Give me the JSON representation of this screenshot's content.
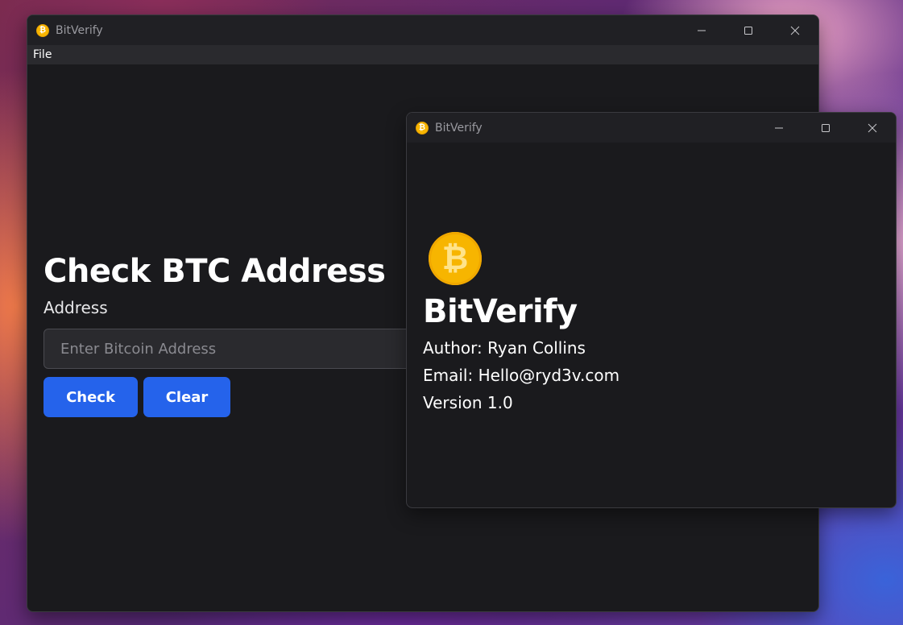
{
  "main_window": {
    "title": "BitVerify",
    "menu": [
      "File"
    ],
    "heading": "Check BTC Address",
    "address_label": "Address",
    "address_input": {
      "value": "",
      "placeholder": "Enter Bitcoin Address"
    },
    "buttons": {
      "check": "Check",
      "clear": "Clear"
    }
  },
  "about_window": {
    "title": "BitVerify",
    "app_name": "BitVerify",
    "author": "Author: Ryan Collins",
    "email": "Email: Hello@ryd3v.com",
    "version": "Version 1.0"
  },
  "icons": {
    "app": "bitcoin-icon",
    "minimize": "minimize-icon",
    "maximize": "maximize-icon",
    "close": "close-icon"
  },
  "colors": {
    "accent": "#2563eb",
    "bitcoin": "#f7b500",
    "window_bg": "#1a1a1d",
    "titlebar_bg": "#202024"
  }
}
